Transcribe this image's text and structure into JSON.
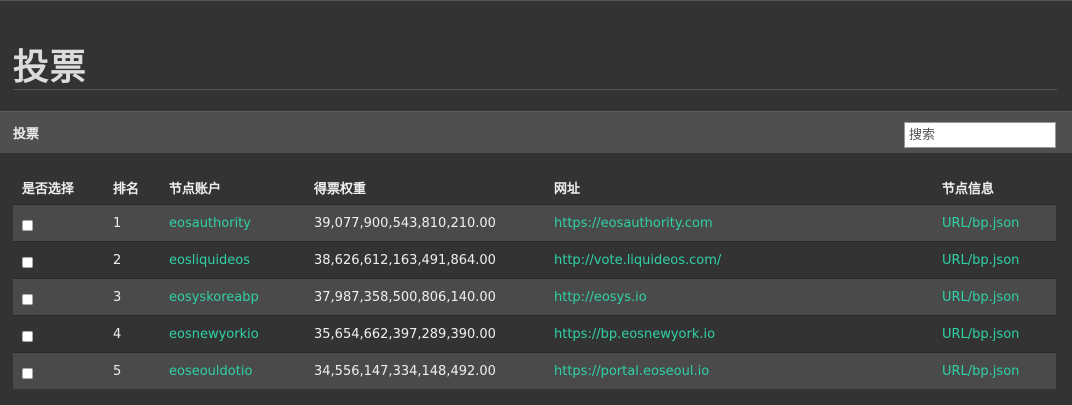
{
  "page": {
    "title": "投票"
  },
  "panel": {
    "title": "投票",
    "search_placeholder": "搜索",
    "search_value": ""
  },
  "table": {
    "headers": {
      "select": "是否选择",
      "rank": "排名",
      "account": "节点账户",
      "weight": "得票权重",
      "url": "网址",
      "info": "节点信息"
    },
    "rows": [
      {
        "checked": false,
        "rank": "1",
        "account": "eosauthority",
        "weight": "39,077,900,543,810,210.00",
        "url": "https://eosauthority.com",
        "info": "URL/bp.json"
      },
      {
        "checked": false,
        "rank": "2",
        "account": "eosliquideos",
        "weight": "38,626,612,163,491,864.00",
        "url": "http://vote.liquideos.com/",
        "info": "URL/bp.json"
      },
      {
        "checked": false,
        "rank": "3",
        "account": "eosyskoreabp",
        "weight": "37,987,358,500,806,140.00",
        "url": "http://eosys.io",
        "info": "URL/bp.json"
      },
      {
        "checked": false,
        "rank": "4",
        "account": "eosnewyorkio",
        "weight": "35,654,662,397,289,390.00",
        "url": "https://bp.eosnewyork.io",
        "info": "URL/bp.json"
      },
      {
        "checked": false,
        "rank": "5",
        "account": "eoseouldotio",
        "weight": "34,556,147,334,148,492.00",
        "url": "https://portal.eoseoul.io",
        "info": "URL/bp.json"
      }
    ]
  },
  "colors": {
    "background": "#333333",
    "panel_header": "#4f4f4f",
    "row_striped": "#4a4a4a",
    "link": "#2fd0a5",
    "text": "#eeeeee"
  }
}
